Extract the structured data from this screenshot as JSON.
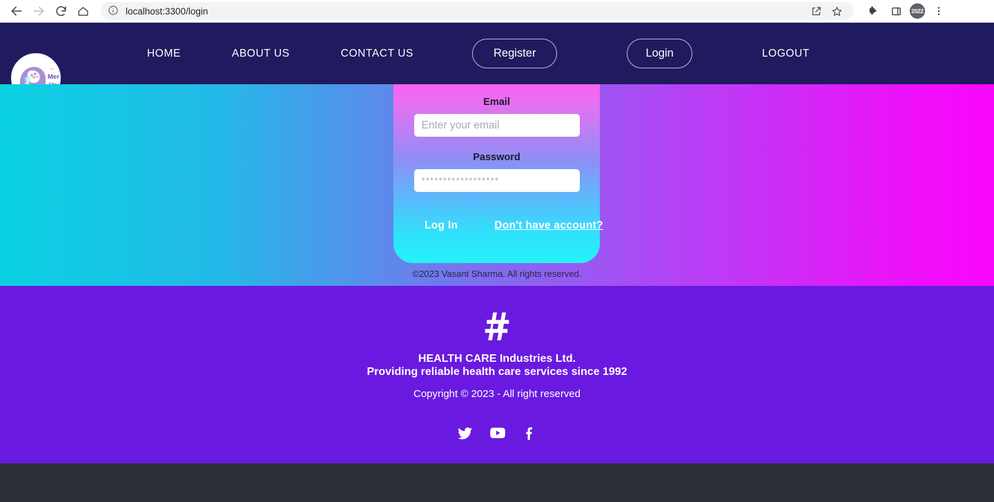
{
  "browser": {
    "url": "localhost:3300/login",
    "back_icon": "back-arrow-icon",
    "forward_icon": "forward-arrow-icon",
    "reload_icon": "reload-icon",
    "home_icon": "home-icon",
    "info_icon": "site-info-icon",
    "share_icon": "share-icon",
    "bookmark_icon": "star-icon",
    "extensions_icon": "puzzle-icon",
    "panel_icon": "side-panel-icon",
    "menu_icon": "three-dot-menu-icon",
    "profile_label": "2022"
  },
  "nav": {
    "logo_alt": "Mental Health",
    "logo_text_top": "Mental",
    "logo_text_bottom": "Health",
    "links": [
      {
        "label": "HOME",
        "name": "nav-link-home"
      },
      {
        "label": "ABOUT US",
        "name": "nav-link-about-us"
      },
      {
        "label": "CONTACT US",
        "name": "nav-link-contact-us"
      }
    ],
    "register_label": "Register",
    "login_label": "Login",
    "logout_label": "LOGOUT"
  },
  "login_card": {
    "email_label": "Email",
    "email_value": "",
    "email_placeholder": "Enter your email",
    "password_label": "Password",
    "password_value": "",
    "password_placeholder": "******************",
    "submit_label": "Log In",
    "register_prompt_label": "Don't have account?"
  },
  "hero": {
    "copyright": "©2023 Vasant Sharma. All rights reserved."
  },
  "footer": {
    "brand_icon": "hashtag-icon",
    "company": "HEALTH CARE Industries Ltd.",
    "tagline": "Providing reliable health care services since 1992",
    "copyright": "Copyright © 2023 - All right reserved",
    "socials": [
      {
        "name": "twitter-icon",
        "label": "Twitter"
      },
      {
        "name": "youtube-icon",
        "label": "YouTube"
      },
      {
        "name": "facebook-icon",
        "label": "Facebook"
      }
    ]
  },
  "colors": {
    "nav_bg": "#201a5e",
    "footer_bg": "#6a1ae0",
    "page_bottom_bg": "#2b3137",
    "hero_gradient_start": "#0bd2e2",
    "hero_gradient_end": "#f907f9"
  }
}
